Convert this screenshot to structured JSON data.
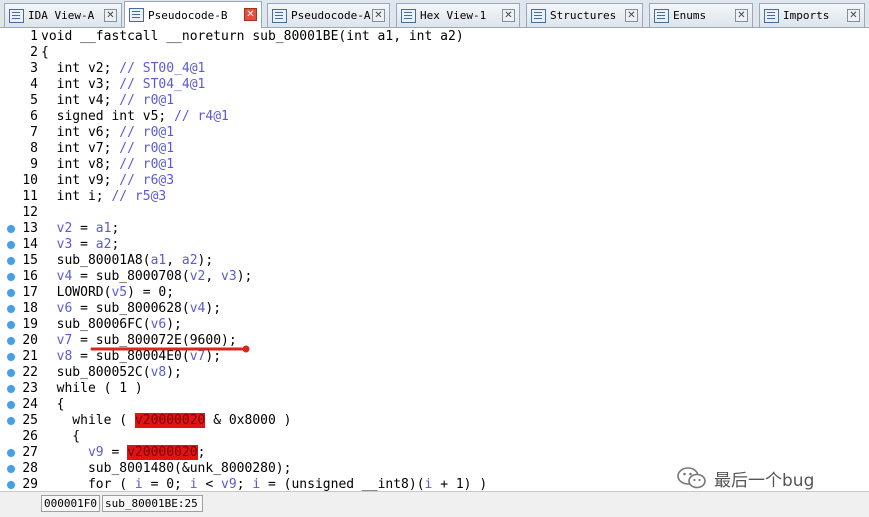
{
  "tabs": [
    {
      "label": "IDA View-A",
      "active": false
    },
    {
      "label": "Pseudocode-B",
      "active": true
    },
    {
      "label": "Pseudocode-A",
      "active": false
    },
    {
      "label": "Hex View-1",
      "active": false
    },
    {
      "label": "Structures",
      "active": false
    },
    {
      "label": "Enums",
      "active": false
    },
    {
      "label": "Imports",
      "active": false
    }
  ],
  "close_glyph": "✕",
  "code_lines": [
    {
      "n": "1",
      "bp": false,
      "segs": [
        [
          "t",
          "void __fastcall __noreturn sub_80001BE(int a1, int a2)"
        ]
      ]
    },
    {
      "n": "2",
      "bp": false,
      "segs": [
        [
          "t",
          "{"
        ]
      ]
    },
    {
      "n": "3",
      "bp": false,
      "segs": [
        [
          "t",
          "  int v2; "
        ],
        [
          "c",
          "// ST00_4@1"
        ]
      ]
    },
    {
      "n": "4",
      "bp": false,
      "segs": [
        [
          "t",
          "  int v3; "
        ],
        [
          "c",
          "// ST04_4@1"
        ]
      ]
    },
    {
      "n": "5",
      "bp": false,
      "segs": [
        [
          "t",
          "  int v4; "
        ],
        [
          "c",
          "// r0@1"
        ]
      ]
    },
    {
      "n": "6",
      "bp": false,
      "segs": [
        [
          "t",
          "  signed int v5; "
        ],
        [
          "c",
          "// r4@1"
        ]
      ]
    },
    {
      "n": "7",
      "bp": false,
      "segs": [
        [
          "t",
          "  int v6; "
        ],
        [
          "c",
          "// r0@1"
        ]
      ]
    },
    {
      "n": "8",
      "bp": false,
      "segs": [
        [
          "t",
          "  int v7; "
        ],
        [
          "c",
          "// r0@1"
        ]
      ]
    },
    {
      "n": "9",
      "bp": false,
      "segs": [
        [
          "t",
          "  int v8; "
        ],
        [
          "c",
          "// r0@1"
        ]
      ]
    },
    {
      "n": "10",
      "bp": false,
      "segs": [
        [
          "t",
          "  int v9; "
        ],
        [
          "c",
          "// r6@3"
        ]
      ]
    },
    {
      "n": "11",
      "bp": false,
      "segs": [
        [
          "t",
          "  int i; "
        ],
        [
          "c",
          "// r5@3"
        ]
      ]
    },
    {
      "n": "12",
      "bp": false,
      "segs": [
        [
          "t",
          ""
        ]
      ]
    },
    {
      "n": "13",
      "bp": true,
      "segs": [
        [
          "t",
          "  "
        ],
        [
          "v",
          "v2"
        ],
        [
          "t",
          " = "
        ],
        [
          "v",
          "a1"
        ],
        [
          "t",
          ";"
        ]
      ]
    },
    {
      "n": "14",
      "bp": true,
      "segs": [
        [
          "t",
          "  "
        ],
        [
          "v",
          "v3"
        ],
        [
          "t",
          " = "
        ],
        [
          "v",
          "a2"
        ],
        [
          "t",
          ";"
        ]
      ]
    },
    {
      "n": "15",
      "bp": true,
      "segs": [
        [
          "t",
          "  sub_80001A8("
        ],
        [
          "v",
          "a1"
        ],
        [
          "t",
          ", "
        ],
        [
          "v",
          "a2"
        ],
        [
          "t",
          ");"
        ]
      ]
    },
    {
      "n": "16",
      "bp": true,
      "segs": [
        [
          "t",
          "  "
        ],
        [
          "v",
          "v4"
        ],
        [
          "t",
          " = sub_8000708("
        ],
        [
          "v",
          "v2"
        ],
        [
          "t",
          ", "
        ],
        [
          "v",
          "v3"
        ],
        [
          "t",
          ");"
        ]
      ]
    },
    {
      "n": "17",
      "bp": true,
      "segs": [
        [
          "t",
          "  LOWORD("
        ],
        [
          "v",
          "v5"
        ],
        [
          "t",
          ") = 0;"
        ]
      ]
    },
    {
      "n": "18",
      "bp": true,
      "segs": [
        [
          "t",
          "  "
        ],
        [
          "v",
          "v6"
        ],
        [
          "t",
          " = sub_8000628("
        ],
        [
          "v",
          "v4"
        ],
        [
          "t",
          ");"
        ]
      ]
    },
    {
      "n": "19",
      "bp": true,
      "segs": [
        [
          "t",
          "  sub_80006FC("
        ],
        [
          "v",
          "v6"
        ],
        [
          "t",
          ");"
        ]
      ]
    },
    {
      "n": "20",
      "bp": true,
      "segs": [
        [
          "t",
          "  "
        ],
        [
          "v",
          "v7"
        ],
        [
          "t",
          " = sub_800072E(9600);"
        ]
      ]
    },
    {
      "n": "21",
      "bp": true,
      "segs": [
        [
          "t",
          "  "
        ],
        [
          "v",
          "v8"
        ],
        [
          "t",
          " = sub_80004E0("
        ],
        [
          "v",
          "v7"
        ],
        [
          "t",
          ");"
        ]
      ]
    },
    {
      "n": "22",
      "bp": true,
      "segs": [
        [
          "t",
          "  sub_800052C("
        ],
        [
          "v",
          "v8"
        ],
        [
          "t",
          ");"
        ]
      ]
    },
    {
      "n": "23",
      "bp": true,
      "segs": [
        [
          "t",
          "  while ( 1 )"
        ]
      ]
    },
    {
      "n": "24",
      "bp": true,
      "segs": [
        [
          "t",
          "  {"
        ]
      ]
    },
    {
      "n": "25",
      "bp": true,
      "segs": [
        [
          "t",
          "    while ( "
        ],
        [
          "h",
          "v20000020"
        ],
        [
          "t",
          " & 0x8000 )"
        ]
      ]
    },
    {
      "n": "26",
      "bp": false,
      "segs": [
        [
          "t",
          "    {"
        ]
      ]
    },
    {
      "n": "27",
      "bp": true,
      "segs": [
        [
          "t",
          "      "
        ],
        [
          "v",
          "v9"
        ],
        [
          "t",
          " = "
        ],
        [
          "h",
          "v20000020"
        ],
        [
          "t",
          ";"
        ]
      ]
    },
    {
      "n": "28",
      "bp": true,
      "segs": [
        [
          "t",
          "      sub_8001480(&unk_8000280);"
        ]
      ]
    },
    {
      "n": "29",
      "bp": true,
      "segs": [
        [
          "t",
          "      for ( "
        ],
        [
          "v",
          "i"
        ],
        [
          "t",
          " = 0; "
        ],
        [
          "v",
          "i"
        ],
        [
          "t",
          " < "
        ],
        [
          "v",
          "v9"
        ],
        [
          "t",
          "; "
        ],
        [
          "v",
          "i"
        ],
        [
          "t",
          " = (unsigned __int8)("
        ],
        [
          "v",
          "i"
        ],
        [
          "t",
          " + 1) )"
        ]
      ]
    }
  ],
  "status": {
    "address": "000001F0",
    "location": "sub_80001BE:25"
  },
  "watermark": "最后一个bug",
  "colors": {
    "breakpoint": "#3ea3e8",
    "highlight": "#e11414",
    "annotation": "#d42a1e",
    "comment": "#5a5ad8"
  }
}
